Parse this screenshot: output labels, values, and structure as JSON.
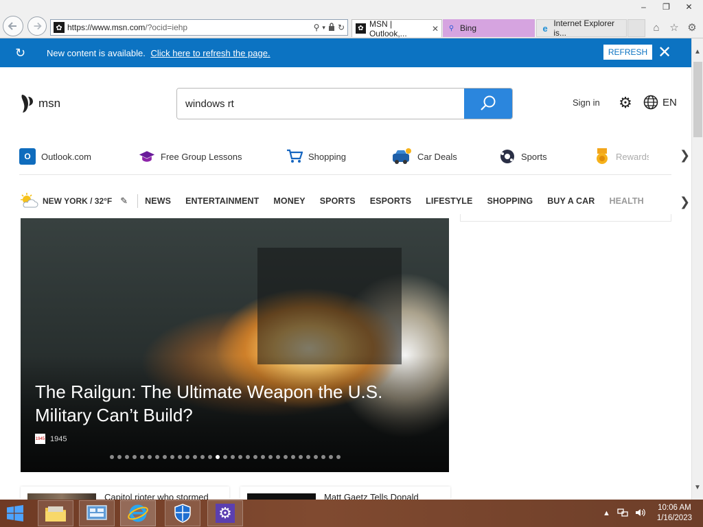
{
  "browser": {
    "url_main": "https://www.msn.com",
    "url_rest": "/?ocid=iehp",
    "tabs": [
      {
        "label": "MSN | Outlook,...",
        "active": true
      },
      {
        "label": "Bing",
        "active": false
      },
      {
        "label": "Internet Explorer is...",
        "active": false
      }
    ]
  },
  "notification": {
    "message": "New content is available.",
    "link": "Click here to refresh the page.",
    "refresh_label": "REFRESH"
  },
  "header": {
    "logo_text": "msn",
    "search_value": "windows rt",
    "signin_label": "Sign in",
    "lang_label": "EN"
  },
  "quick_links": [
    {
      "label": "Outlook.com",
      "icon": "outlook-icon"
    },
    {
      "label": "Free Group Lessons",
      "icon": "graduation-cap-icon"
    },
    {
      "label": "Shopping",
      "icon": "cart-icon"
    },
    {
      "label": "Car Deals",
      "icon": "car-icon"
    },
    {
      "label": "Sports",
      "icon": "soccer-ball-icon"
    },
    {
      "label": "Rewards",
      "icon": "medal-icon"
    }
  ],
  "weather": {
    "location": "NEW YORK / 32°F"
  },
  "categories": [
    "NEWS",
    "ENTERTAINMENT",
    "MONEY",
    "SPORTS",
    "ESPORTS",
    "LIFESTYLE",
    "SHOPPING",
    "BUY A CAR",
    "HEALTH"
  ],
  "hero": {
    "title": "The Railgun: The Ultimate Weapon the U.S. Military Can’t Build?",
    "source": "1945",
    "source_logo": "1945",
    "dot_count": 31,
    "active_dot": 14
  },
  "cards": [
    {
      "text": "Capitol rioter who stormed"
    },
    {
      "text": "Matt Gaetz Tells Donald"
    }
  ],
  "taskbar": {
    "time": "10:06 AM",
    "date": "1/16/2023"
  },
  "colors": {
    "notif_bar": "#0c73c2",
    "search_button": "#2b86dd",
    "bing_tab": "#d6a4e0",
    "taskbar": "#7a4329"
  }
}
